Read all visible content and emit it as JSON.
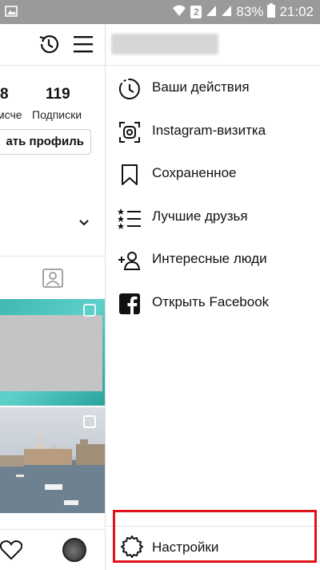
{
  "status_bar": {
    "battery": "83%",
    "time": "21:02",
    "sim": "2"
  },
  "profile": {
    "stats": [
      {
        "value": "8",
        "label": "мсче"
      },
      {
        "value": "119",
        "label": "Подписки"
      }
    ],
    "edit_button": "ать профиль"
  },
  "drawer": {
    "menu": [
      {
        "label": "Ваши действия",
        "icon": "activity-icon"
      },
      {
        "label": "Instagram-визитка",
        "icon": "nametag-icon"
      },
      {
        "label": "Сохраненное",
        "icon": "bookmark-icon"
      },
      {
        "label": "Лучшие друзья",
        "icon": "close-friends-icon"
      },
      {
        "label": "Интересные люди",
        "icon": "discover-people-icon"
      },
      {
        "label": "Открыть Facebook",
        "icon": "facebook-icon"
      }
    ],
    "settings": {
      "label": "Настройки",
      "icon": "settings-icon"
    }
  },
  "colors": {
    "status_bar": "#9a9a9a",
    "highlight_border": "#e2121a",
    "photo_teal": "#3fb8b2"
  }
}
